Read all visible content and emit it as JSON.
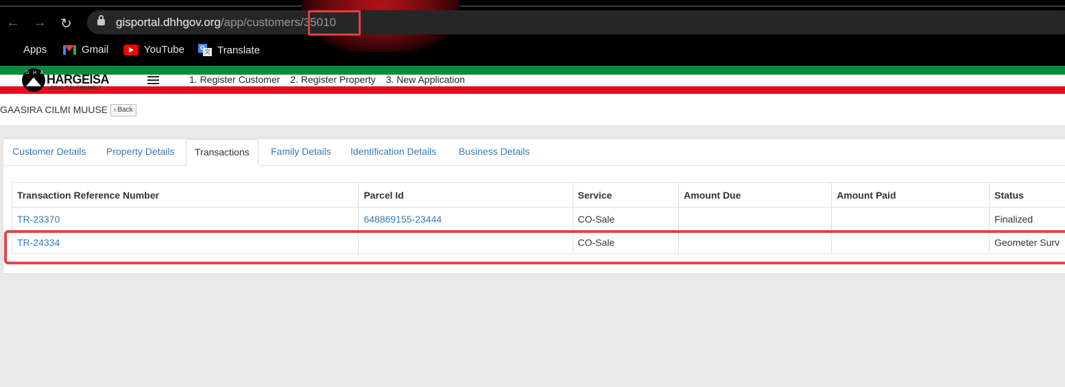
{
  "browser": {
    "url_host": "gisportal.dhhgov.org",
    "url_path": "/app/customers/35010",
    "bookmarks": [
      {
        "label": "Apps",
        "icon": "apps-grid-icon"
      },
      {
        "label": "Gmail",
        "icon": "gmail-icon"
      },
      {
        "label": "YouTube",
        "icon": "youtube-icon"
      },
      {
        "label": "Translate",
        "icon": "translate-icon"
      }
    ]
  },
  "app": {
    "logo_name": "HARGEISA",
    "logo_sub": "LOCAL GOVERNMENT",
    "logo_initials": "D H A",
    "nav": [
      "1. Register Customer",
      "2. Register Property",
      "3. New Application"
    ]
  },
  "customer": {
    "name": "GAASIRA CILMI MUUSE",
    "back_label": "Back"
  },
  "tabs": [
    "Customer Details",
    "Property Details",
    "Transactions",
    "Family Details",
    "Identification Details",
    "Business Details"
  ],
  "active_tab": "Transactions",
  "table": {
    "headers": [
      "Transaction Reference Number",
      "Parcel Id",
      "Service",
      "Amount Due",
      "Amount Paid",
      "Status"
    ],
    "rows": [
      [
        "TR-23370",
        "648869155-23444",
        "CO-Sale",
        "",
        "",
        "Finalized"
      ],
      [
        "TR-24334",
        "",
        "CO-Sale",
        "",
        "",
        "Geometer Surv"
      ]
    ]
  },
  "colors": {
    "link": "#337ab7",
    "annotation": "#e24040",
    "flag_green": "#0b8a3c",
    "flag_red": "#e30d1e"
  }
}
